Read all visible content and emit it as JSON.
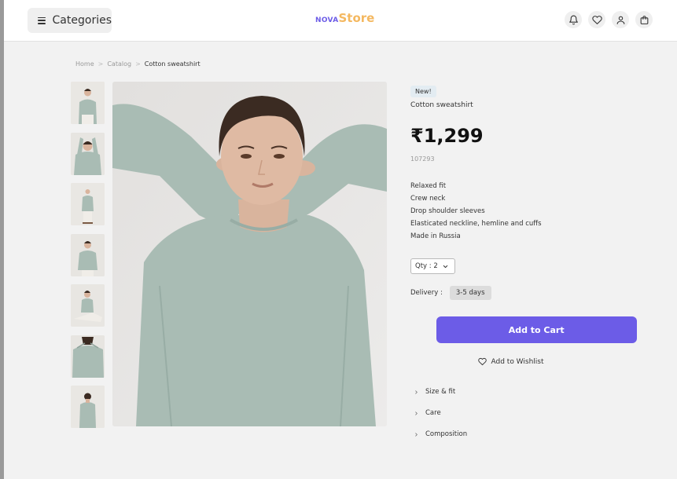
{
  "header": {
    "categories_label": "Categories",
    "logo_prefix": "NOVA",
    "logo_main": "Store",
    "icons": [
      "bell-icon",
      "heart-icon",
      "user-icon",
      "cart-icon"
    ]
  },
  "breadcrumb": [
    "Home",
    "Catalog",
    "Cotton sweatshirt"
  ],
  "product": {
    "badge": "New!",
    "name": "Cotton sweatshirt",
    "price": "₹1,299",
    "sku": "107293",
    "features": [
      "Relaxed fit",
      "Crew neck",
      "Drop shoulder sleeves",
      "Elasticated neckline, hemline and cuffs",
      "Made in Russia"
    ],
    "qty_label": "Qty : 2",
    "delivery_label": "Delivery :",
    "delivery_value": "3-5 days",
    "add_to_cart": "Add to Cart",
    "add_to_wishlist": "Add to Wishlist",
    "accordion": [
      "Size & fit",
      "Care",
      "Composition"
    ]
  },
  "gallery": {
    "thumbnail_count": 7
  },
  "colors": {
    "accent": "#6c5ce7",
    "logo_secondary": "#f4b860",
    "sweater": "#a9bcb4",
    "page_bg": "#f2f2f2"
  }
}
